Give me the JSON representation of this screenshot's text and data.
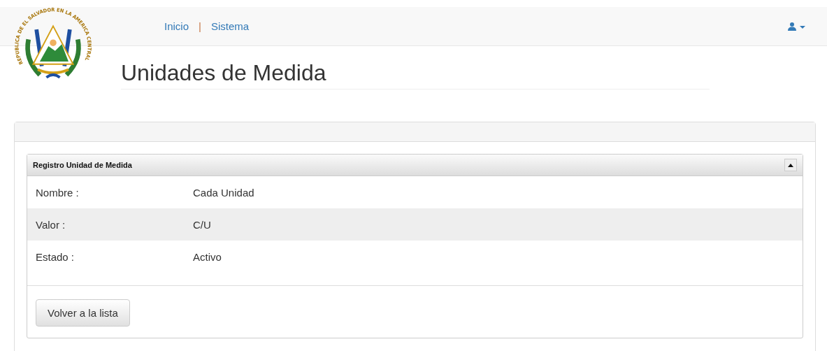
{
  "emblem_text": "REPUBLICA DE EL SALVADOR EN LA AMERICA CENTRAL",
  "nav": [
    {
      "label": "Inicio"
    },
    {
      "label": "Sistema"
    }
  ],
  "nav_separator": "|",
  "page_title": "Unidades de Medida",
  "record_panel": {
    "title": "Registro Unidad de Medida",
    "collapsed": false,
    "fields": [
      {
        "label": "Nombre :",
        "value": "Cada Unidad"
      },
      {
        "label": "Valor :",
        "value": "C/U"
      },
      {
        "label": "Estado :",
        "value": "Activo"
      }
    ],
    "back_button": "Volver a la lista"
  }
}
